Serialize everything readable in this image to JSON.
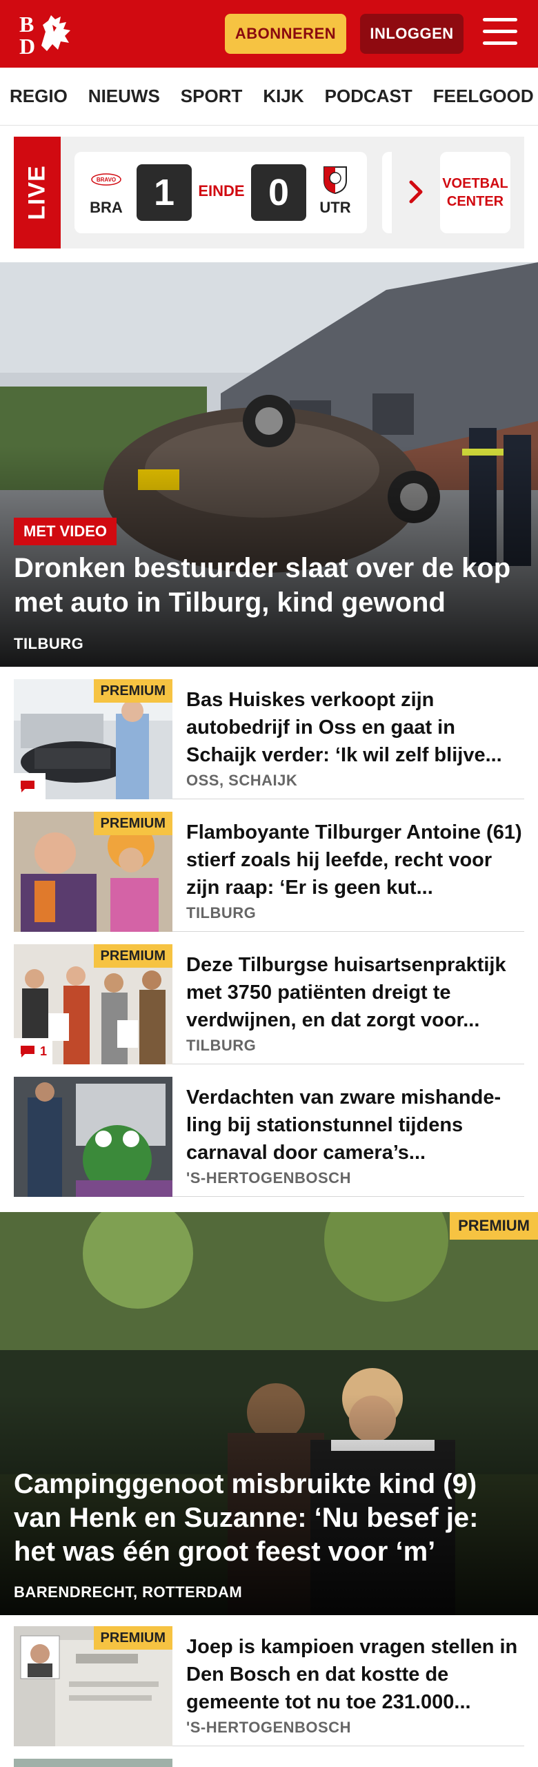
{
  "header": {
    "logo_letters": "BD",
    "subscribe_label": "ABONNEREN",
    "login_label": "INLOGGEN",
    "colors": {
      "brand": "#d10a11",
      "accent": "#f6c342",
      "login_bg": "#8f0a10"
    }
  },
  "nav": {
    "items": [
      {
        "label": "REGIO"
      },
      {
        "label": "NIEUWS"
      },
      {
        "label": "SPORT"
      },
      {
        "label": "KIJK"
      },
      {
        "label": "PODCAST"
      },
      {
        "label": "FEELGOOD"
      }
    ]
  },
  "live": {
    "label": "LIVE",
    "match": {
      "home": {
        "abbr": "BRA",
        "crest_text": "BRAVO",
        "score": "1"
      },
      "away": {
        "abbr": "UTR",
        "score": "0"
      },
      "status": "EINDE"
    },
    "center_label_1": "VOETBAL",
    "center_label_2": "CENTER"
  },
  "hero1": {
    "badge": "MET VIDEO",
    "title": "Dronken bestuurder slaat over de kop met auto in Tilburg, kind gewond",
    "location": "TILBURG"
  },
  "articles": [
    {
      "premium": "PREMIUM",
      "title": "Bas Huiskes verkoopt zijn autobedrijf in Oss en gaat in Schaijk verder: ‘Ik wil zelf blijve...",
      "location": "OSS, SCHAIJK",
      "comments": ""
    },
    {
      "premium": "PREMIUM",
      "title": "Flamboyante Tilburger Antoine (61) stierf zoals hij leefde, recht voor zijn raap: ‘Er is geen kut...",
      "location": "TILBURG"
    },
    {
      "premium": "PREMIUM",
      "title": "Deze Tilburgse huisartsenprak­tijk met 3750 patiënten dreigt te verdwijnen, en dat zorgt voor...",
      "location": "TILBURG",
      "comments": "1"
    },
    {
      "title": "Verdachten van zware mishande­ling bij stationstunnel tijdens carnaval door camera’s...",
      "location": "'S-HERTOGENBOSCH"
    }
  ],
  "hero2": {
    "premium": "PREMIUM",
    "title": "Campinggenoot misbruikte kind (9) van Henk en Suzanne: ‘Nu besef je: het was één groot feest voor ‘m’",
    "location": "BARENDRECHT, ROTTERDAM"
  },
  "article5": {
    "premium": "PREMIUM",
    "title": "Joep is kampioen vragen stellen in Den Bosch en dat kostte de gemeente tot nu toe 231.000...",
    "location": "'S-HERTOGENBOSCH"
  }
}
